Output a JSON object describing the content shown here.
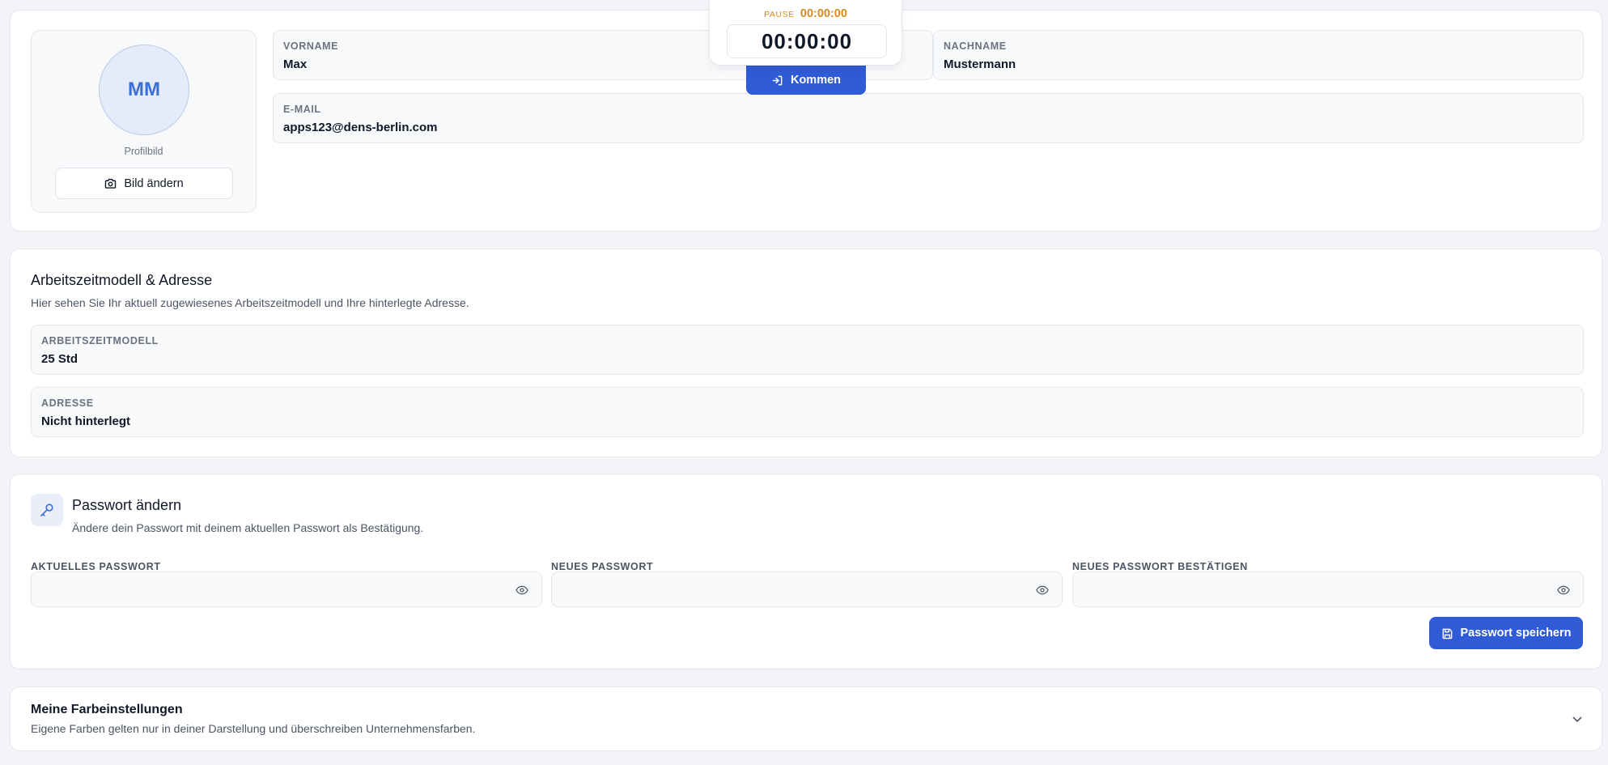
{
  "profile": {
    "initials": "MM",
    "avatar_caption": "Profilbild",
    "change_picture_label": "Bild ändern",
    "first_name_label": "VORNAME",
    "first_name_value": "Max",
    "last_name_label": "NACHNAME",
    "last_name_value": "Mustermann",
    "email_label": "E-MAIL",
    "email_value": "apps123@dens-berlin.com"
  },
  "timer": {
    "pause_label": "PAUSE",
    "pause_time": "00:00:00",
    "main_time": "00:00:00",
    "clock_in_label": "Kommen"
  },
  "work_model": {
    "title": "Arbeitszeitmodell & Adresse",
    "subtitle": "Hier sehen Sie Ihr aktuell zugewiesenes Arbeitszeitmodell und Ihre hinterlegte Adresse.",
    "model_label": "ARBEITSZEITMODELL",
    "model_value": "25 Std",
    "address_label": "ADRESSE",
    "address_value": "Nicht hinterlegt"
  },
  "password": {
    "title": "Passwort ändern",
    "subtitle": "Ändere dein Passwort mit deinem aktuellen Passwort als Bestätigung.",
    "current_label": "AKTUELLES PASSWORT",
    "new_label": "NEUES PASSWORT",
    "confirm_label": "NEUES PASSWORT BESTÄTIGEN",
    "save_label": "Passwort speichern"
  },
  "colors_section": {
    "title": "Meine Farbeinstellungen",
    "subtitle": "Eigene Farben gelten nur in deiner Darstellung und überschreiben Unternehmensfarben."
  },
  "icons": {
    "change_picture": "camera-icon",
    "clock_in": "login-icon",
    "password": "key-icon",
    "reveal": "eye-icon",
    "save": "save-icon",
    "expand": "chevron-down-icon"
  },
  "colors": {
    "accent": "#2f5bd6",
    "pause": "#d98a1c",
    "avatar_bg": "#e4ebf9",
    "avatar_text": "#3b6fd8"
  }
}
